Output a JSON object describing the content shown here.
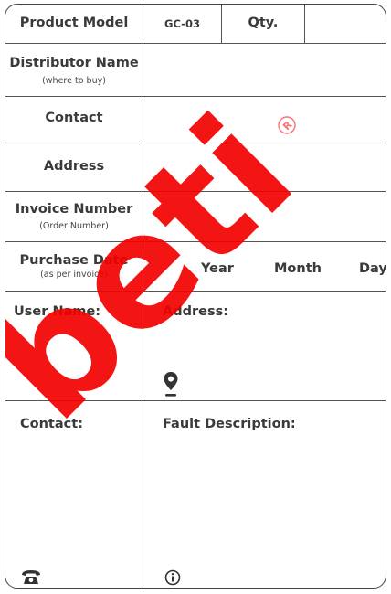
{
  "header": {
    "product_model_label": "Product Model",
    "model_value": "GC-03",
    "qty_label": "Qty.",
    "qty_value": ""
  },
  "rows": {
    "distributor_label": "Distributor Name",
    "distributor_sub": "(where to buy)",
    "contact_label": "Contact",
    "address_label": "Address",
    "invoice_label": "Invoice Number",
    "invoice_sub": "(Order Number)",
    "purchase_label": "Purchase Date",
    "purchase_sub": "(as per invoice)",
    "year_label": "Year",
    "month_label": "Month",
    "day_label": "Day"
  },
  "user_section": {
    "user_name_label": "User Name:",
    "address_label": "Address:"
  },
  "fault_section": {
    "contact_label": "Contact:",
    "fault_label": "Fault Description:"
  },
  "watermark": {
    "text": "beti",
    "mark": "®",
    "color": "#f20000"
  },
  "icons": {
    "location": "map-pin-icon",
    "phone": "telephone-icon",
    "info": "info-circle-icon"
  }
}
